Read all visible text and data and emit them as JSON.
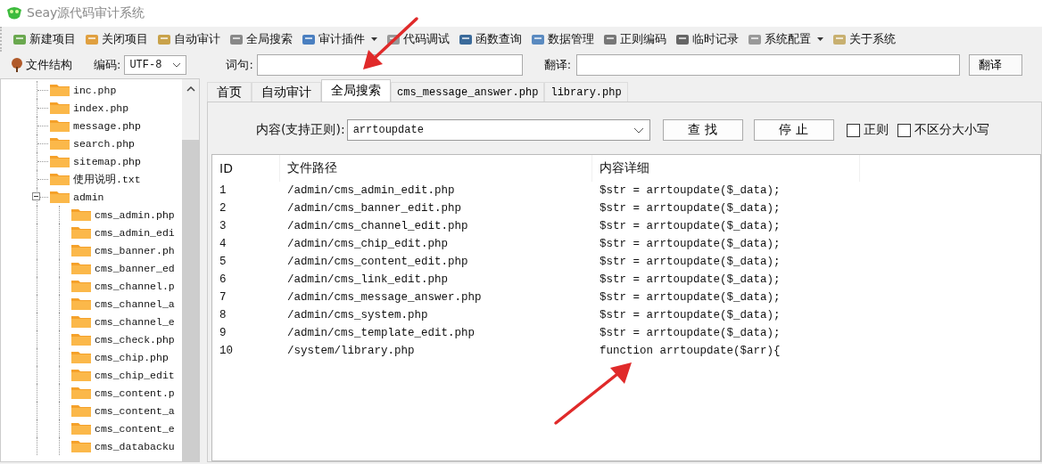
{
  "window": {
    "title": "Seay源代码审计系统"
  },
  "toolbar": [
    {
      "label": "新建项目",
      "has_menu": false
    },
    {
      "label": "关闭项目",
      "has_menu": false
    },
    {
      "label": "自动审计",
      "has_menu": false
    },
    {
      "label": "全局搜索",
      "has_menu": false
    },
    {
      "label": "审计插件",
      "has_menu": true
    },
    {
      "label": "代码调试",
      "has_menu": false
    },
    {
      "label": "函数查询",
      "has_menu": false
    },
    {
      "label": "数据管理",
      "has_menu": false
    },
    {
      "label": "正则编码",
      "has_menu": false
    },
    {
      "label": "临时记录",
      "has_menu": false
    },
    {
      "label": "系统配置",
      "has_menu": true
    },
    {
      "label": "关于系统",
      "has_menu": false
    }
  ],
  "second_bar": {
    "file_structure": "文件结构",
    "encoding_label": "编码:",
    "encoding": "UTF-8",
    "word_label": "词句:",
    "translate_label": "翻译:",
    "translate_button": "翻译"
  },
  "tree": [
    {
      "name": "inc.php"
    },
    {
      "name": "index.php"
    },
    {
      "name": "message.php"
    },
    {
      "name": "search.php"
    },
    {
      "name": "sitemap.php"
    },
    {
      "name": "使用说明.txt"
    },
    {
      "name": "admin",
      "expanded": true,
      "children": [
        {
          "name": "cms_admin.php"
        },
        {
          "name": "cms_admin_edi"
        },
        {
          "name": "cms_banner.ph"
        },
        {
          "name": "cms_banner_ed"
        },
        {
          "name": "cms_channel.p"
        },
        {
          "name": "cms_channel_a"
        },
        {
          "name": "cms_channel_e"
        },
        {
          "name": "cms_check.php"
        },
        {
          "name": "cms_chip.php"
        },
        {
          "name": "cms_chip_edit"
        },
        {
          "name": "cms_content.p"
        },
        {
          "name": "cms_content_a"
        },
        {
          "name": "cms_content_e"
        },
        {
          "name": "cms_databacku"
        }
      ]
    }
  ],
  "tabs": [
    {
      "label": "首页",
      "selected": false
    },
    {
      "label": "自动审计",
      "selected": false
    },
    {
      "label": "全局搜索",
      "selected": true
    },
    {
      "label": "cms_message_answer.php",
      "selected": false
    },
    {
      "label": "library.php",
      "selected": false
    }
  ],
  "search": {
    "label": "内容(支持正则):",
    "value": "arrtoupdate",
    "find_button": "查 找",
    "stop_button": "停 止",
    "options": [
      {
        "label": "正则",
        "checked": false
      },
      {
        "label": "不区分大小写",
        "checked": false
      }
    ]
  },
  "table": {
    "columns": [
      "ID",
      "文件路径",
      "内容详细"
    ],
    "rows": [
      [
        "1",
        "/admin/cms_admin_edit.php",
        "$str = arrtoupdate($_data);"
      ],
      [
        "2",
        "/admin/cms_banner_edit.php",
        "$str = arrtoupdate($_data);"
      ],
      [
        "3",
        "/admin/cms_channel_edit.php",
        "$str = arrtoupdate($_data);"
      ],
      [
        "4",
        "/admin/cms_chip_edit.php",
        "$str = arrtoupdate($_data);"
      ],
      [
        "5",
        "/admin/cms_content_edit.php",
        "$str = arrtoupdate($_data);"
      ],
      [
        "6",
        "/admin/cms_link_edit.php",
        "$str = arrtoupdate($_data);"
      ],
      [
        "7",
        "/admin/cms_message_answer.php",
        "$str = arrtoupdate($_data);"
      ],
      [
        "8",
        "/admin/cms_system.php",
        "$str = arrtoupdate($_data);"
      ],
      [
        "9",
        "/admin/cms_template_edit.php",
        "$str = arrtoupdate($_data);"
      ],
      [
        "10",
        "/system/library.php",
        "function arrtoupdate($arr){"
      ]
    ]
  }
}
